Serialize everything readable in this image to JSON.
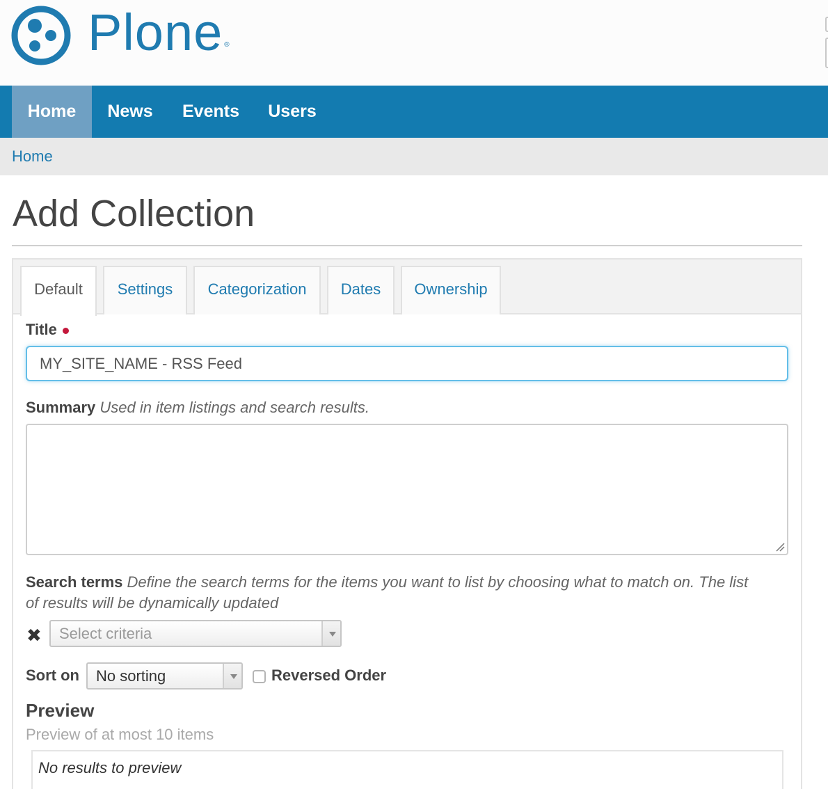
{
  "brand": {
    "name": "Plone",
    "mark": "®",
    "color": "#1f7bb0"
  },
  "nav": {
    "items": [
      {
        "label": "Home",
        "active": true
      },
      {
        "label": "News"
      },
      {
        "label": "Events"
      },
      {
        "label": "Users"
      }
    ]
  },
  "breadcrumb": {
    "home": "Home"
  },
  "page": {
    "title": "Add Collection"
  },
  "tabs": [
    {
      "label": "Default",
      "active": true
    },
    {
      "label": "Settings"
    },
    {
      "label": "Categorization"
    },
    {
      "label": "Dates"
    },
    {
      "label": "Ownership"
    }
  ],
  "form": {
    "title": {
      "label": "Title",
      "value": "MY_SITE_NAME - RSS Feed",
      "required": true
    },
    "summary": {
      "label": "Summary",
      "help": "Used in item listings and search results.",
      "value": ""
    },
    "search_terms": {
      "label": "Search terms",
      "help": "Define the search terms for the items you want to list by choosing what to match on. The list",
      "help_line2": "of results will be dynamically updated",
      "criteria_placeholder": "Select criteria",
      "remove_icon": "close-icon"
    },
    "sort_on": {
      "label": "Sort on",
      "value": "No sorting",
      "reversed_label": "Reversed Order",
      "reversed_checked": false
    },
    "preview": {
      "title": "Preview",
      "subtitle": "Preview of at most 10 items",
      "empty": "No results to preview"
    }
  },
  "colors": {
    "nav_bg": "#137bb0",
    "nav_active": "#6fa0c3",
    "link": "#1f7bb0",
    "focus": "#64bee8",
    "required": "#c4183c"
  }
}
